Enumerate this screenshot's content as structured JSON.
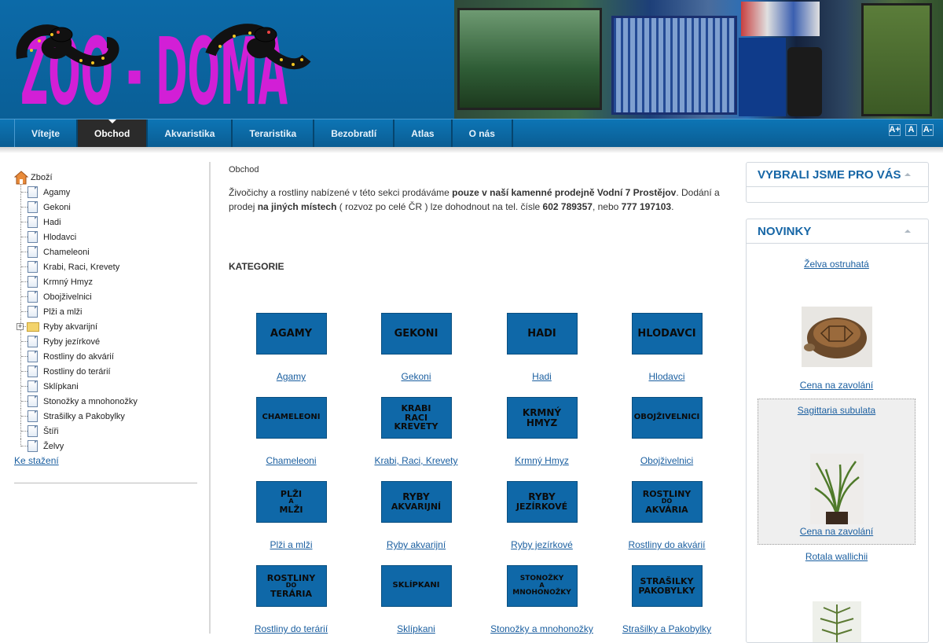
{
  "header": {
    "logo_text": "ZOO - DOMA"
  },
  "nav": {
    "items": [
      {
        "label": "Vítejte",
        "active": false
      },
      {
        "label": "Obchod",
        "active": true
      },
      {
        "label": "Akvaristika",
        "active": false
      },
      {
        "label": "Teraristika",
        "active": false
      },
      {
        "label": "Bezobratlí",
        "active": false
      },
      {
        "label": "Atlas",
        "active": false
      },
      {
        "label": "O nás",
        "active": false
      }
    ],
    "font_controls": [
      "A+",
      "A",
      "A-"
    ]
  },
  "sidebar": {
    "root_label": "Zboží",
    "items": [
      {
        "label": "Agamy",
        "icon": "document-icon"
      },
      {
        "label": "Gekoni",
        "icon": "document-icon"
      },
      {
        "label": "Hadi",
        "icon": "document-icon"
      },
      {
        "label": "Hlodavci",
        "icon": "document-icon"
      },
      {
        "label": "Chameleoni",
        "icon": "document-icon"
      },
      {
        "label": "Krabi, Raci, Krevety",
        "icon": "document-icon"
      },
      {
        "label": "Krmný Hmyz",
        "icon": "document-icon"
      },
      {
        "label": "Obojživelnici",
        "icon": "document-icon"
      },
      {
        "label": "Plži a mlži",
        "icon": "document-icon"
      },
      {
        "label": "Ryby akvarijní",
        "icon": "folder-icon"
      },
      {
        "label": "Ryby jezírkové",
        "icon": "document-icon"
      },
      {
        "label": "Rostliny do akvárií",
        "icon": "document-icon"
      },
      {
        "label": "Rostliny do terárií",
        "icon": "document-icon"
      },
      {
        "label": "Sklípkani",
        "icon": "document-icon"
      },
      {
        "label": "Stonožky a mnohonožky",
        "icon": "document-icon"
      },
      {
        "label": "Strašilky a Pakobylky",
        "icon": "document-icon"
      },
      {
        "label": "Štíři",
        "icon": "document-icon"
      },
      {
        "label": "Želvy",
        "icon": "document-icon"
      }
    ],
    "download_label": "Ke stažení"
  },
  "main": {
    "breadcrumb": "Obchod",
    "intro": {
      "p1": "Živočichy a rostliny nabízené v této sekci prodáváme ",
      "b1": "pouze v naší kamenné prodejně Vodní 7 Prostějov",
      "p2": ". Dodání a prodej ",
      "b2": "na jiných místech",
      "p3": " ( rozvoz po celé ČR ) lze dohodnout na tel. čísle ",
      "b3": "602 789357",
      "p4": ", nebo ",
      "b4": "777 197103",
      "p5": "."
    },
    "categories_title": "KATEGORIE",
    "categories": [
      {
        "tile": [
          "AGAMY"
        ],
        "label": "Agamy"
      },
      {
        "tile": [
          "GEKONI"
        ],
        "label": "Gekoni"
      },
      {
        "tile": [
          "HADI"
        ],
        "label": "Hadi"
      },
      {
        "tile": [
          "HLODAVCI"
        ],
        "label": "Hlodavci"
      },
      {
        "tile": [
          "CHAMELEONI"
        ],
        "label": "Chameleoni"
      },
      {
        "tile": [
          "KRABI",
          "RACI",
          "KREVETY"
        ],
        "label": "Krabi, Raci, Krevety"
      },
      {
        "tile": [
          "KRMNÝ",
          "HMYZ"
        ],
        "label": "Krmný Hmyz"
      },
      {
        "tile": [
          "OBOJŽIVELNICI"
        ],
        "label": "Obojživelnici"
      },
      {
        "tile": [
          "PLŽI",
          "A",
          "MLŽI"
        ],
        "label": "Plži a mlži"
      },
      {
        "tile": [
          "RYBY",
          "AKVARIJNÍ"
        ],
        "label": "Ryby akvarijní"
      },
      {
        "tile": [
          "RYBY",
          "JEZÍRKOVÉ"
        ],
        "label": "Ryby jezírkové"
      },
      {
        "tile": [
          "ROSTLINY",
          "DO",
          "AKVÁRIA"
        ],
        "label": "Rostliny do akvárií"
      },
      {
        "tile": [
          "ROSTLINY",
          "DO",
          "TERÁRIA"
        ],
        "label": "Rostliny do terárií"
      },
      {
        "tile": [
          "SKLÍPKANI"
        ],
        "label": "Sklípkani"
      },
      {
        "tile": [
          "STONOŽKY",
          "A",
          "MNOHONOŽKY"
        ],
        "label": "Stonožky a mnohonožky"
      },
      {
        "tile": [
          "STRAŠILKY",
          "PAKOBYLKY"
        ],
        "label": "Strašilky a Pakobylky"
      }
    ]
  },
  "right": {
    "box1_title": "VYBRALI JSME PRO VÁS",
    "box2_title": "NOVINKY",
    "news": [
      {
        "name": "Želva ostruhatá",
        "price": "Cena na zavolání"
      },
      {
        "name": "Sagittaria subulata",
        "price": "Cena na zavolání"
      },
      {
        "name": "Rotala wallichii",
        "price": ""
      }
    ]
  }
}
